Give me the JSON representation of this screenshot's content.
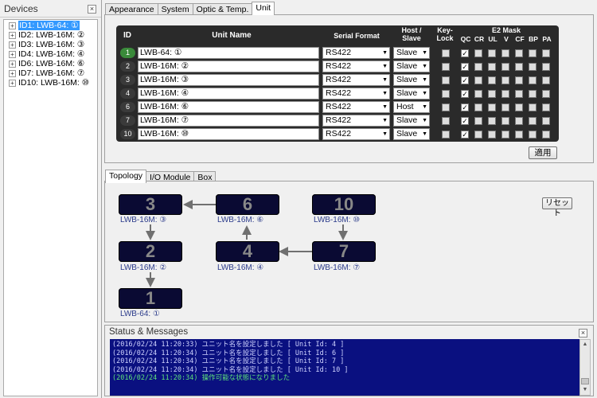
{
  "devices": {
    "title": "Devices",
    "close_glyph": "×",
    "items": [
      {
        "label": "ID1: LWB-64: ①",
        "selected": true
      },
      {
        "label": "ID2: LWB-16M: ②"
      },
      {
        "label": "ID3: LWB-16M: ③"
      },
      {
        "label": "ID4: LWB-16M: ④"
      },
      {
        "label": "ID6: LWB-16M: ⑥"
      },
      {
        "label": "ID7: LWB-16M: ⑦"
      },
      {
        "label": "ID10: LWB-16M: ⑩"
      }
    ]
  },
  "top_tabs": [
    "Appearance",
    "System",
    "Optic & Temp.",
    "Unit"
  ],
  "unit_table": {
    "headers": {
      "id": "ID",
      "name": "Unit Name",
      "serial": "Serial Format",
      "host": "Host /",
      "slave": "Slave",
      "key": "Key-",
      "lock": "Lock",
      "e2": "E2 Mask",
      "qc": "QC",
      "cr": "CR",
      "ul": "UL",
      "v": "V",
      "cf": "CF",
      "bp": "BP",
      "pa": "PA"
    },
    "rows": [
      {
        "id": "1",
        "name": "LWB-64: ①",
        "serial": "RS422",
        "host": "Slave",
        "qc": true
      },
      {
        "id": "2",
        "name": "LWB-16M: ②",
        "serial": "RS422",
        "host": "Slave",
        "qc": true
      },
      {
        "id": "3",
        "name": "LWB-16M: ③",
        "serial": "RS422",
        "host": "Slave",
        "qc": true
      },
      {
        "id": "4",
        "name": "LWB-16M: ④",
        "serial": "RS422",
        "host": "Slave",
        "qc": true
      },
      {
        "id": "6",
        "name": "LWB-16M: ⑥",
        "serial": "RS422",
        "host": "Host",
        "qc": true
      },
      {
        "id": "7",
        "name": "LWB-16M: ⑦",
        "serial": "RS422",
        "host": "Slave",
        "qc": true
      },
      {
        "id": "10",
        "name": "LWB-16M: ⑩",
        "serial": "RS422",
        "host": "Slave",
        "qc": true
      }
    ],
    "apply_label": "適用"
  },
  "bottom_tabs": [
    "Topology",
    "I/O Module",
    "Box"
  ],
  "topology": {
    "reset_label": "リセット",
    "nodes": [
      {
        "num": "3",
        "label": "LWB-16M: ③"
      },
      {
        "num": "6",
        "label": "LWB-16M: ⑥"
      },
      {
        "num": "10",
        "label": "LWB-16M: ⑩"
      },
      {
        "num": "2",
        "label": "LWB-16M: ②"
      },
      {
        "num": "4",
        "label": "LWB-16M: ④"
      },
      {
        "num": "7",
        "label": "LWB-16M: ⑦"
      },
      {
        "num": "1",
        "label": "LWB-64: ①"
      }
    ]
  },
  "status": {
    "title": "Status & Messages",
    "messages": [
      {
        "text": "(2016/02/24 11:20:33) ユニット名を設定しました [ Unit Id: 4 ]"
      },
      {
        "text": "(2016/02/24 11:20:34) ユニット名を設定しました [ Unit Id: 6 ]"
      },
      {
        "text": "(2016/02/24 11:20:34) ユニット名を設定しました [ Unit Id: 7 ]"
      },
      {
        "text": "(2016/02/24 11:20:34) ユニット名を設定しました [ Unit Id: 10 ]"
      },
      {
        "text": "(2016/02/24 11:20:34) 操作可能な状態になりました",
        "ok": true
      }
    ]
  },
  "colors": {
    "node_bg": "#0a0a33",
    "msg_bg": "#0a1080",
    "msg_ok": "#5ee07a",
    "selection": "#3399ff"
  },
  "icons": {
    "expand": "plus-box-icon",
    "dropdown": "chevron-down-icon",
    "close": "close-icon"
  }
}
